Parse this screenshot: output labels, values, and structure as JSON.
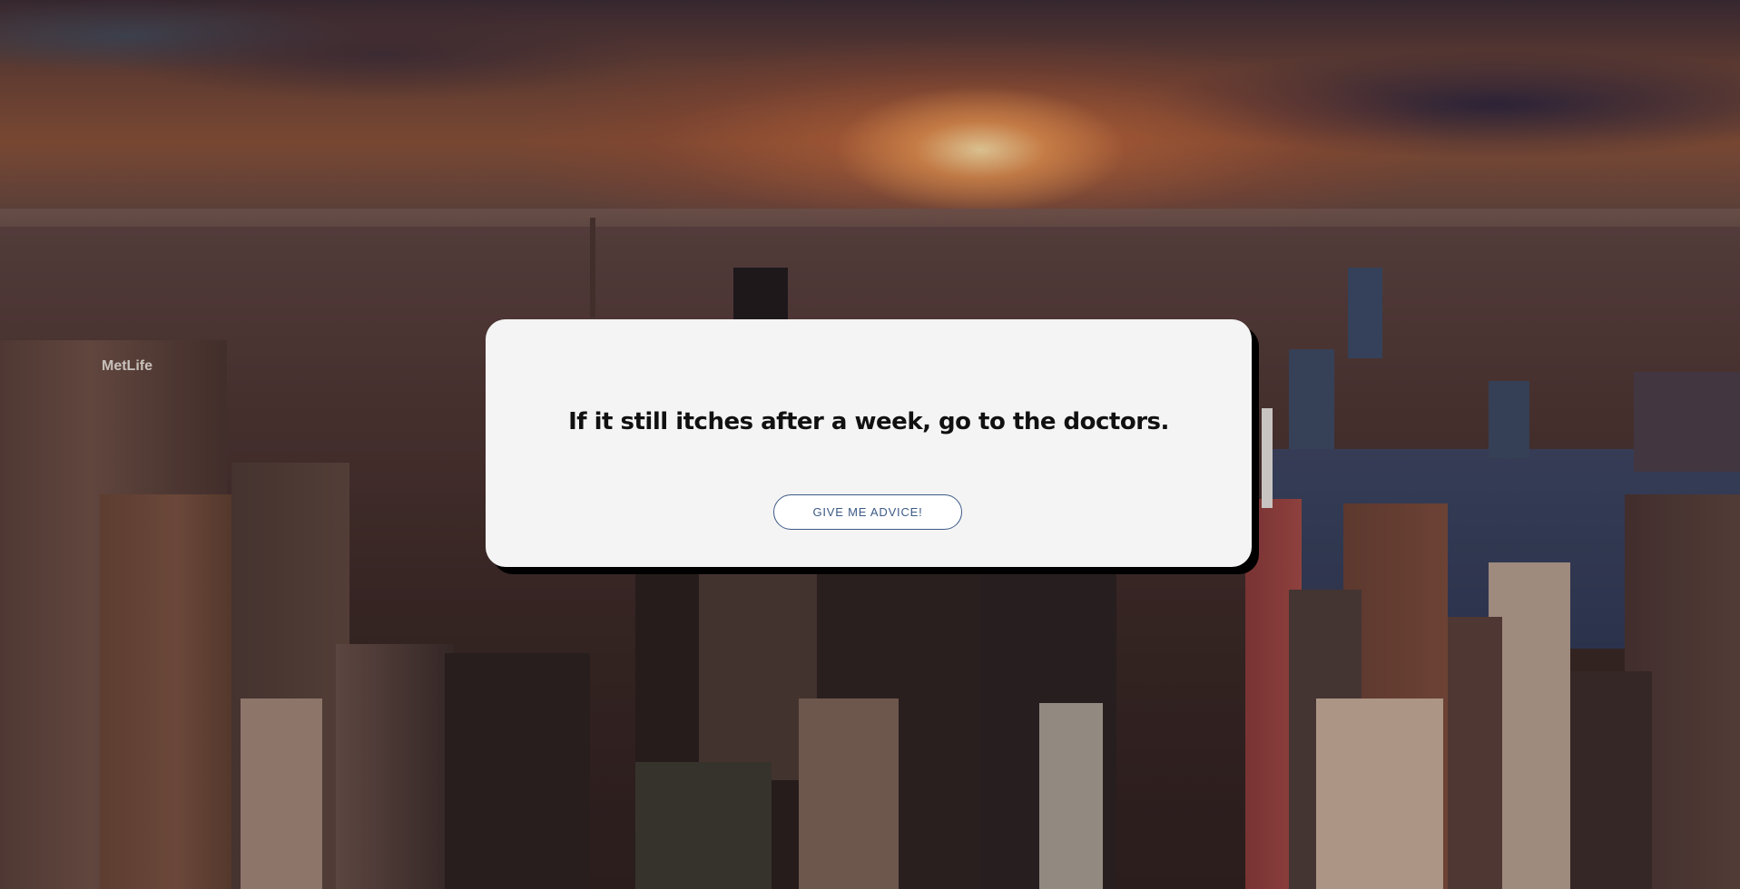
{
  "background": {
    "description_icon": "city-skyline-sunset-photo",
    "building_sign": "MetLife"
  },
  "advice": {
    "text": "If it still itches after a week, go to the doctors.",
    "button_label": "GIVE ME ADVICE!"
  },
  "colors": {
    "card_bg": "#f4f4f4",
    "card_shadow": "#000000",
    "button_accent": "#3c5a86",
    "text": "#111111"
  }
}
